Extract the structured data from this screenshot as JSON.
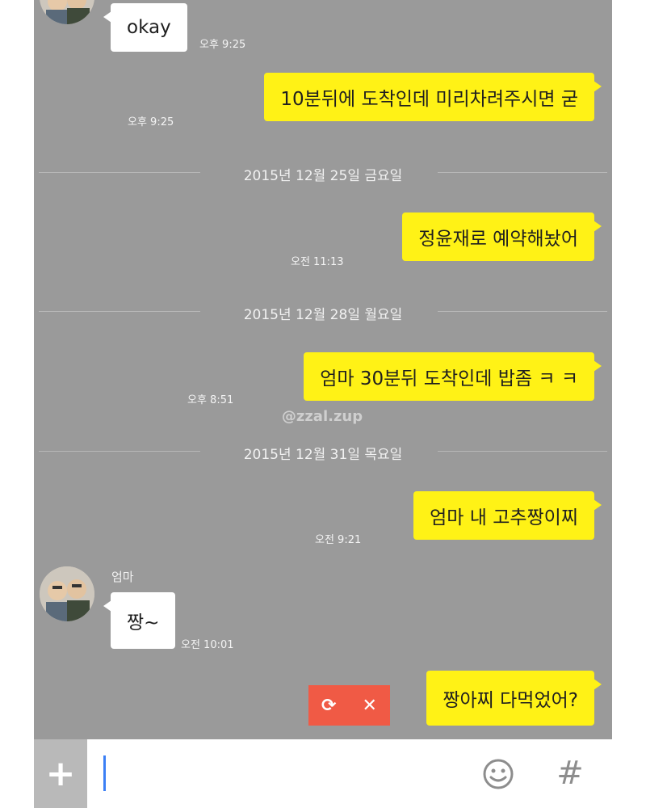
{
  "chat": {
    "messages": [
      {
        "sender": "them",
        "text": "okay",
        "time": "오후 9:25"
      },
      {
        "sender": "me",
        "text": "10분뒤에 도착인데 미리차려주시면 굳",
        "time": "오후 9:25"
      },
      {
        "sender": "me",
        "text": "정윤재로 예약해놨어",
        "time": "오전 11:13"
      },
      {
        "sender": "me",
        "text": "엄마 30분뒤 도착인데 밥좀 ㅋ ㅋ",
        "time": "오후 8:51"
      },
      {
        "sender": "me",
        "text": "엄마 내 고추짱이찌",
        "time": "오전 9:21"
      },
      {
        "sender": "them",
        "name": "엄마",
        "text": "짱~",
        "time": "오전 10:01"
      },
      {
        "sender": "me",
        "text": "짱아찌 다먹었어?",
        "status": "failed"
      }
    ],
    "date_separators": [
      "2015년 12월 25일 금요일",
      "2015년 12월 28일 월요일",
      "2015년 12월 31일 목요일"
    ],
    "watermark": "@zzal.zup"
  },
  "failed_actions": {
    "retry_icon": "retry-icon",
    "delete_icon": "close-icon",
    "retry_glyph": "⟳",
    "delete_glyph": "✕"
  },
  "input_bar": {
    "add_label": "+",
    "emoji_icon": "smiley-icon",
    "hash_label": "#"
  },
  "colors": {
    "chat_bg": "#9a9a9a",
    "my_bubble": "#fff216",
    "their_bubble": "#ffffff",
    "failed_bg": "#f05a45",
    "caret": "#3b7ff5"
  }
}
